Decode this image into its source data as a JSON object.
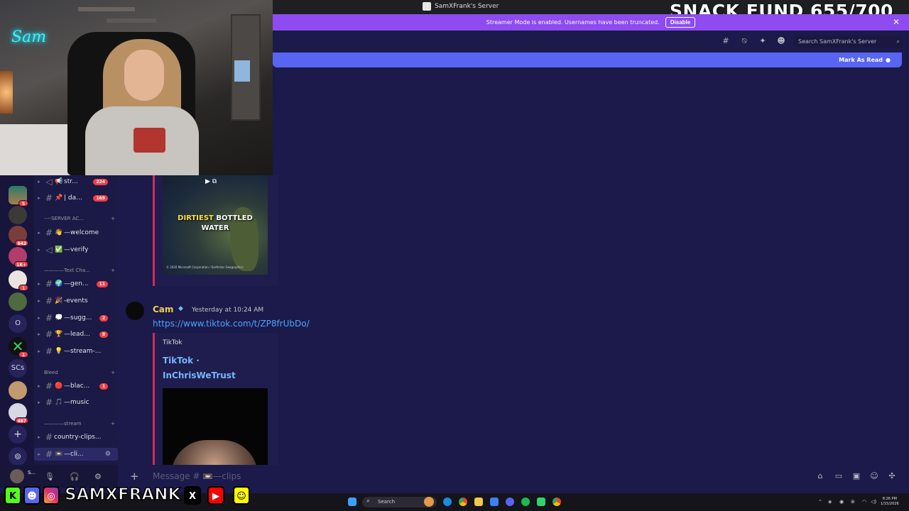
{
  "window": {
    "server_title": "SamXFrank's Server"
  },
  "overlay": {
    "snack_fund": "SNACK FUND 655/700",
    "handle": "SAMXFRANK",
    "webcam_sign": "Sam"
  },
  "banner": {
    "text": "Streamer Mode is enabled. Usernames have been truncated.",
    "disable_label": "Disable",
    "close": "✕"
  },
  "header": {
    "search_placeholder": "Search SamXFrank's Server",
    "icons": [
      "threads-icon",
      "mute-icon",
      "pin-icon",
      "members-icon"
    ]
  },
  "newbar": {
    "label": "Mark As Read"
  },
  "servers": {
    "badges": [
      "5",
      "642",
      "1K+",
      "1",
      "1",
      "487"
    ],
    "text_items": [
      "O",
      "SCs"
    ],
    "colors": {
      "badge_red": "#f23f43",
      "rail": "#17153c"
    }
  },
  "channels": {
    "items": [
      {
        "emoji": "📢",
        "name": "str...",
        "badge": "224",
        "type": "announce"
      },
      {
        "emoji": "📌",
        "name": "| da...",
        "badge": "169",
        "type": "text"
      },
      {
        "emoji": "👋",
        "name": "—welcome",
        "badge": "",
        "type": "text"
      },
      {
        "emoji": "✅",
        "name": "—verify",
        "badge": "",
        "type": "announce"
      },
      {
        "emoji": "🌍",
        "name": "—gen...",
        "badge": "11",
        "type": "text"
      },
      {
        "emoji": "🎉",
        "name": "-events",
        "badge": "",
        "type": "text"
      },
      {
        "emoji": "💭",
        "name": "—sugg...",
        "badge": "2",
        "type": "text"
      },
      {
        "emoji": "🏆",
        "name": "—lead...",
        "badge": "8",
        "type": "text"
      },
      {
        "emoji": "💡",
        "name": "—stream-...",
        "badge": "",
        "type": "text"
      },
      {
        "emoji": "🔴",
        "name": "—blac...",
        "badge": "1",
        "type": "text"
      },
      {
        "emoji": "🎵",
        "name": "—music",
        "badge": "",
        "type": "text"
      },
      {
        "emoji": "",
        "name": "country-clips...",
        "badge": "",
        "type": "text"
      },
      {
        "emoji": "📼",
        "name": "—cli...",
        "badge": "",
        "type": "text"
      }
    ],
    "categories": [
      "----SERVER AC...",
      "————Text Cha...",
      "Bleed",
      "————stream"
    ]
  },
  "messages": {
    "embed1": {
      "caption_highlight": "DIRTIEST",
      "caption_rest": " BOTTLED",
      "caption_line2": "WATER",
      "copyright": "© 2020 Microsoft Corporation / Earthstar Geographics"
    },
    "message2": {
      "author": "Cam",
      "timestamp": "Yesterday at 10:24 AM",
      "link": "https://www.tiktok.com/t/ZP8frUbDo/",
      "embed_provider": "TikTok",
      "embed_title_line1": "TikTok ·",
      "embed_title_line2": "InChrisWeTrust"
    }
  },
  "user_panel": {
    "name": "S..."
  },
  "composer": {
    "placeholder": "Message # 📼—clips"
  },
  "taskbar": {
    "search_label": "Search",
    "time": "8:26 PM",
    "date": "1/15/2026"
  }
}
